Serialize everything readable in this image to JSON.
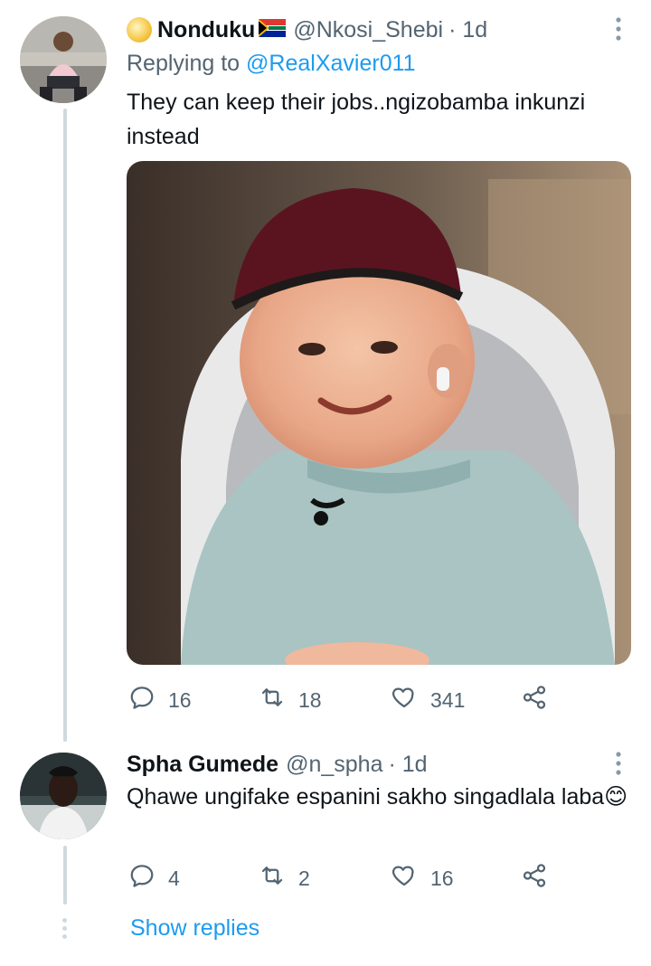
{
  "tweet1": {
    "name": "Nonduku",
    "handle": "@Nkosi_Shebi",
    "time": "· 1d",
    "replying_prefix": "Replying to ",
    "replying_handle": "@RealXavier011",
    "text": "They can keep their jobs..ngizobamba inkunzi instead",
    "replies": "16",
    "retweets": "18",
    "likes": "341"
  },
  "tweet2": {
    "name": "Spha Gumede",
    "handle": "@n_spha",
    "time": "· 1d",
    "text": "Qhawe ungifake espanini sakho singadlala laba",
    "emoji": "😊",
    "replies": "4",
    "retweets": "2",
    "likes": "16"
  },
  "show_replies": "Show replies",
  "colors": {
    "link": "#1d9bf0",
    "secondary": "#536471",
    "thread_line": "#cfd9de"
  },
  "icons": [
    "reply-icon",
    "retweet-icon",
    "like-icon",
    "share-icon",
    "more-icon",
    "emoji-badge-icon",
    "south-africa-flag-icon"
  ]
}
